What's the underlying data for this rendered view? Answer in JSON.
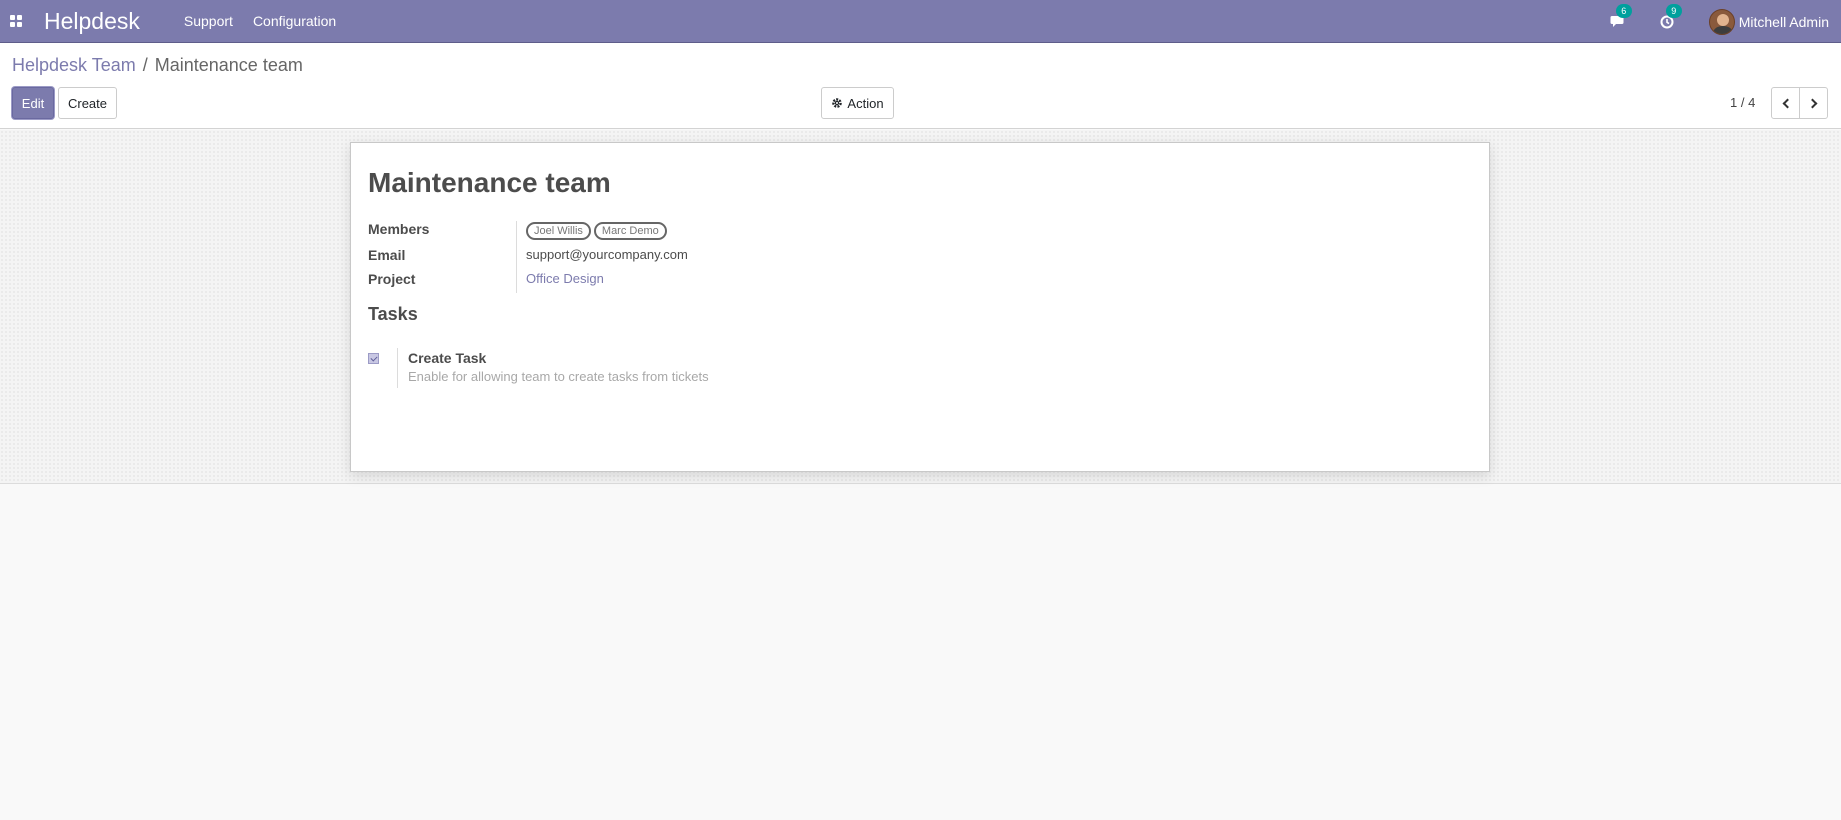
{
  "navbar": {
    "app_title": "Helpdesk",
    "menu": [
      "Support",
      "Configuration"
    ],
    "messages_badge": "6",
    "activities_badge": "9",
    "user_name": "Mitchell Admin"
  },
  "control_panel": {
    "breadcrumb_parent": "Helpdesk Team",
    "breadcrumb_separator": "/",
    "breadcrumb_current": "Maintenance team",
    "edit_label": "Edit",
    "create_label": "Create",
    "action_label": "Action",
    "pager_value": "1 / 4"
  },
  "form": {
    "title": "Maintenance team",
    "members_label": "Members",
    "members": [
      "Joel Willis",
      "Marc Demo"
    ],
    "email_label": "Email",
    "email_value": "support@yourcompany.com",
    "project_label": "Project",
    "project_value": "Office Design",
    "section_title": "Tasks",
    "create_task_title": "Create Task",
    "create_task_help": "Enable for allowing team to create tasks from tickets",
    "create_task_checked": true
  },
  "colors": {
    "brand": "#7c7bad",
    "badge": "#00a09d"
  },
  "icons": {
    "apps": "apps-grid-icon",
    "messages": "chat-icon",
    "activities": "clock-icon",
    "action": "gear-icon",
    "prev": "chevron-left-icon",
    "next": "chevron-right-icon"
  }
}
